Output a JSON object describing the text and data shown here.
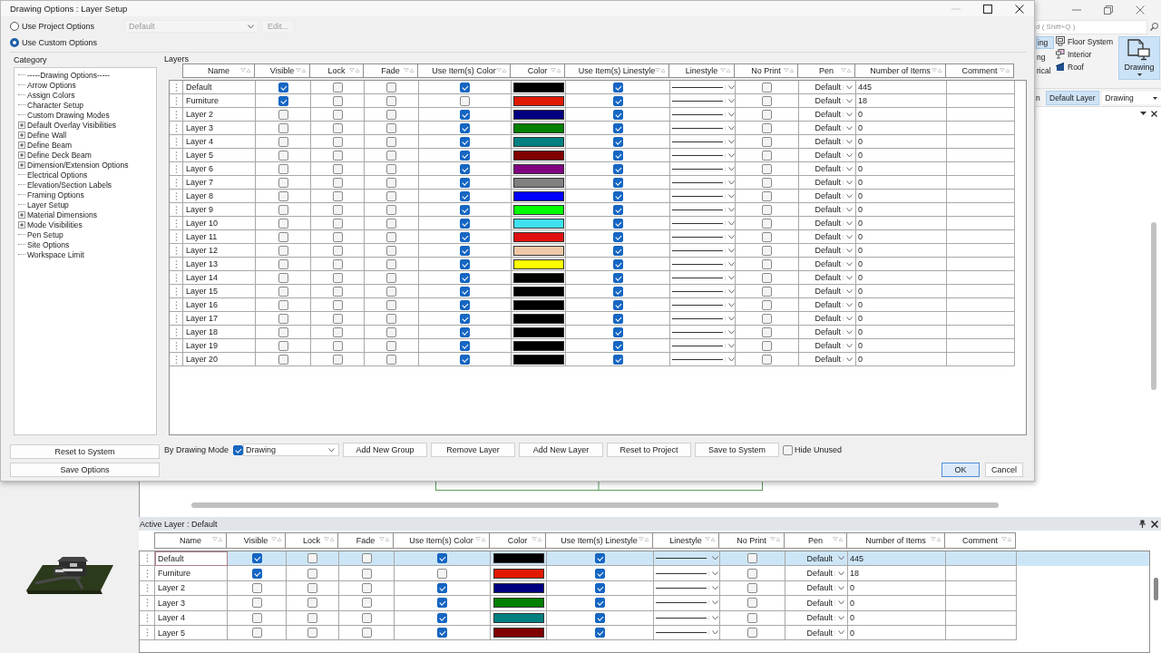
{
  "app": {
    "search": {
      "placeholder": "d ( Shift+Q )"
    },
    "ribbon": {
      "cut_items": [
        {
          "label": "ing",
          "selected": true
        },
        {
          "label": "ng",
          "selected": false
        },
        {
          "label": "rical",
          "selected": false
        }
      ],
      "items": [
        "Floor System",
        "Interior",
        "Roof"
      ],
      "big_button": {
        "label": "Drawing",
        "selected": true
      }
    },
    "layer_bar": {
      "cut_label": "n",
      "layer": "Default Layer",
      "mode": "Drawing"
    }
  },
  "dialog": {
    "title": "Drawing Options : Layer Setup",
    "source_options": [
      {
        "label": "Use Project Options",
        "selected": false
      },
      {
        "label": "Use Custom Options",
        "selected": true
      }
    ],
    "project_preset": {
      "value": "Default",
      "disabled": true
    },
    "edit_button": {
      "label": "Edit...",
      "disabled": true
    },
    "category": {
      "label": "Category",
      "items": [
        {
          "label": "-----Drawing Options-----",
          "collapsed": false
        },
        {
          "label": "Arrow Options",
          "collapsed": false
        },
        {
          "label": "Assign Colors",
          "collapsed": false
        },
        {
          "label": "Character Setup",
          "collapsed": false
        },
        {
          "label": "Custom Drawing Modes",
          "collapsed": false
        },
        {
          "label": "Default Overlay Visibilities",
          "collapsed": true
        },
        {
          "label": "Define Wall",
          "collapsed": true
        },
        {
          "label": "Define Beam",
          "collapsed": true
        },
        {
          "label": "Define Deck Beam",
          "collapsed": true
        },
        {
          "label": "Dimension/Extension Options",
          "collapsed": true
        },
        {
          "label": "Electrical Options",
          "collapsed": false
        },
        {
          "label": "Elevation/Section Labels",
          "collapsed": false
        },
        {
          "label": "Framing Options",
          "collapsed": false
        },
        {
          "label": "Layer Setup",
          "collapsed": false
        },
        {
          "label": "Material Dimensions",
          "collapsed": true
        },
        {
          "label": "Mode Visibilities",
          "collapsed": true
        },
        {
          "label": "Pen Setup",
          "collapsed": false
        },
        {
          "label": "Site Options",
          "collapsed": false
        },
        {
          "label": "Workspace Limit",
          "collapsed": false
        }
      ]
    },
    "left_buttons": [
      "Reset to System",
      "Save Options"
    ],
    "layers": {
      "label": "Layers",
      "columns": [
        "Name",
        "Visible",
        "Lock",
        "Fade",
        "Use Item(s) Color",
        "Color",
        "Use Item(s) Linestyle",
        "Linestyle",
        "No Print",
        "Pen",
        "Number of Items",
        "Comment"
      ],
      "rows": [
        {
          "name": "Default",
          "visible": true,
          "lock": false,
          "fade": false,
          "use_item_color": true,
          "color": "#000000",
          "use_item_linestyle": true,
          "no_print": false,
          "pen": "Default",
          "items": "445"
        },
        {
          "name": "Furniture",
          "visible": true,
          "lock": false,
          "fade": false,
          "use_item_color": false,
          "color": "#e01a00",
          "use_item_linestyle": true,
          "no_print": false,
          "pen": "Default",
          "items": "18"
        },
        {
          "name": "Layer 2",
          "visible": false,
          "lock": false,
          "fade": false,
          "use_item_color": true,
          "color": "#000080",
          "use_item_linestyle": true,
          "no_print": false,
          "pen": "Default",
          "items": "0"
        },
        {
          "name": "Layer 3",
          "visible": false,
          "lock": false,
          "fade": false,
          "use_item_color": true,
          "color": "#008000",
          "use_item_linestyle": true,
          "no_print": false,
          "pen": "Default",
          "items": "0"
        },
        {
          "name": "Layer 4",
          "visible": false,
          "lock": false,
          "fade": false,
          "use_item_color": true,
          "color": "#008080",
          "use_item_linestyle": true,
          "no_print": false,
          "pen": "Default",
          "items": "0"
        },
        {
          "name": "Layer 5",
          "visible": false,
          "lock": false,
          "fade": false,
          "use_item_color": true,
          "color": "#800000",
          "use_item_linestyle": true,
          "no_print": false,
          "pen": "Default",
          "items": "0"
        },
        {
          "name": "Layer 6",
          "visible": false,
          "lock": false,
          "fade": false,
          "use_item_color": true,
          "color": "#800080",
          "use_item_linestyle": true,
          "no_print": false,
          "pen": "Default",
          "items": "0"
        },
        {
          "name": "Layer 7",
          "visible": false,
          "lock": false,
          "fade": false,
          "use_item_color": true,
          "color": "#808080",
          "use_item_linestyle": true,
          "no_print": false,
          "pen": "Default",
          "items": "0"
        },
        {
          "name": "Layer 8",
          "visible": false,
          "lock": false,
          "fade": false,
          "use_item_color": true,
          "color": "#0000ff",
          "use_item_linestyle": true,
          "no_print": false,
          "pen": "Default",
          "items": "0"
        },
        {
          "name": "Layer 9",
          "visible": false,
          "lock": false,
          "fade": false,
          "use_item_color": true,
          "color": "#00ff00",
          "use_item_linestyle": true,
          "no_print": false,
          "pen": "Default",
          "items": "0"
        },
        {
          "name": "Layer 10",
          "visible": false,
          "lock": false,
          "fade": false,
          "use_item_color": true,
          "color": "#40e0f0",
          "use_item_linestyle": true,
          "no_print": false,
          "pen": "Default",
          "items": "0"
        },
        {
          "name": "Layer 11",
          "visible": false,
          "lock": false,
          "fade": false,
          "use_item_color": true,
          "color": "#e01010",
          "use_item_linestyle": true,
          "no_print": false,
          "pen": "Default",
          "items": "0"
        },
        {
          "name": "Layer 12",
          "visible": false,
          "lock": false,
          "fade": false,
          "use_item_color": true,
          "color": "#f0c8a8",
          "use_item_linestyle": true,
          "no_print": false,
          "pen": "Default",
          "items": "0"
        },
        {
          "name": "Layer 13",
          "visible": false,
          "lock": false,
          "fade": false,
          "use_item_color": true,
          "color": "#ffff00",
          "use_item_linestyle": true,
          "no_print": false,
          "pen": "Default",
          "items": "0"
        },
        {
          "name": "Layer 14",
          "visible": false,
          "lock": false,
          "fade": false,
          "use_item_color": true,
          "color": "#000000",
          "use_item_linestyle": true,
          "no_print": false,
          "pen": "Default",
          "items": "0"
        },
        {
          "name": "Layer 15",
          "visible": false,
          "lock": false,
          "fade": false,
          "use_item_color": true,
          "color": "#000000",
          "use_item_linestyle": true,
          "no_print": false,
          "pen": "Default",
          "items": "0"
        },
        {
          "name": "Layer 16",
          "visible": false,
          "lock": false,
          "fade": false,
          "use_item_color": true,
          "color": "#000000",
          "use_item_linestyle": true,
          "no_print": false,
          "pen": "Default",
          "items": "0"
        },
        {
          "name": "Layer 17",
          "visible": false,
          "lock": false,
          "fade": false,
          "use_item_color": true,
          "color": "#000000",
          "use_item_linestyle": true,
          "no_print": false,
          "pen": "Default",
          "items": "0"
        },
        {
          "name": "Layer 18",
          "visible": false,
          "lock": false,
          "fade": false,
          "use_item_color": true,
          "color": "#000000",
          "use_item_linestyle": true,
          "no_print": false,
          "pen": "Default",
          "items": "0"
        },
        {
          "name": "Layer 19",
          "visible": false,
          "lock": false,
          "fade": false,
          "use_item_color": true,
          "color": "#000000",
          "use_item_linestyle": true,
          "no_print": false,
          "pen": "Default",
          "items": "0"
        },
        {
          "name": "Layer 20",
          "visible": false,
          "lock": false,
          "fade": false,
          "use_item_color": true,
          "color": "#000000",
          "use_item_linestyle": true,
          "no_print": false,
          "pen": "Default",
          "items": "0"
        }
      ]
    },
    "by_drawing_mode": {
      "label": "By Drawing Mode",
      "checked": true,
      "value": "Drawing"
    },
    "actions": [
      "Add New Group",
      "Remove Layer",
      "Add New Layer",
      "Reset to Project",
      "Save to System"
    ],
    "hide_unused": {
      "label": "Hide Unused",
      "checked": false
    },
    "ok_button": {
      "label": "OK",
      "focused": true
    },
    "cancel_button": {
      "label": "Cancel",
      "focused": false
    }
  },
  "active_layer": {
    "title": "Active Layer : Default",
    "columns": [
      "Name",
      "Visible",
      "Lock",
      "Fade",
      "Use Item(s) Color",
      "Color",
      "Use Item(s) Linestyle",
      "Linestyle",
      "No Print",
      "Pen",
      "Number of Items",
      "Comment"
    ],
    "rows": [
      {
        "name": "Default",
        "selected": true,
        "visible": true,
        "lock": false,
        "fade": false,
        "use_item_color": true,
        "color": "#000000",
        "use_item_linestyle": true,
        "no_print": false,
        "pen": "Default",
        "items": "445"
      },
      {
        "name": "Furniture",
        "selected": false,
        "visible": true,
        "lock": false,
        "fade": false,
        "use_item_color": false,
        "color": "#e01a00",
        "use_item_linestyle": true,
        "no_print": false,
        "pen": "Default",
        "items": "18"
      },
      {
        "name": "Layer 2",
        "selected": false,
        "visible": false,
        "lock": false,
        "fade": false,
        "use_item_color": true,
        "color": "#000080",
        "use_item_linestyle": true,
        "no_print": false,
        "pen": "Default",
        "items": "0"
      },
      {
        "name": "Layer 3",
        "selected": false,
        "visible": false,
        "lock": false,
        "fade": false,
        "use_item_color": true,
        "color": "#008000",
        "use_item_linestyle": true,
        "no_print": false,
        "pen": "Default",
        "items": "0"
      },
      {
        "name": "Layer 4",
        "selected": false,
        "visible": false,
        "lock": false,
        "fade": false,
        "use_item_color": true,
        "color": "#008080",
        "use_item_linestyle": true,
        "no_print": false,
        "pen": "Default",
        "items": "0"
      },
      {
        "name": "Layer 5",
        "selected": false,
        "visible": false,
        "lock": false,
        "fade": false,
        "use_item_color": true,
        "color": "#800000",
        "use_item_linestyle": true,
        "no_print": false,
        "pen": "Default",
        "items": "0"
      }
    ]
  }
}
